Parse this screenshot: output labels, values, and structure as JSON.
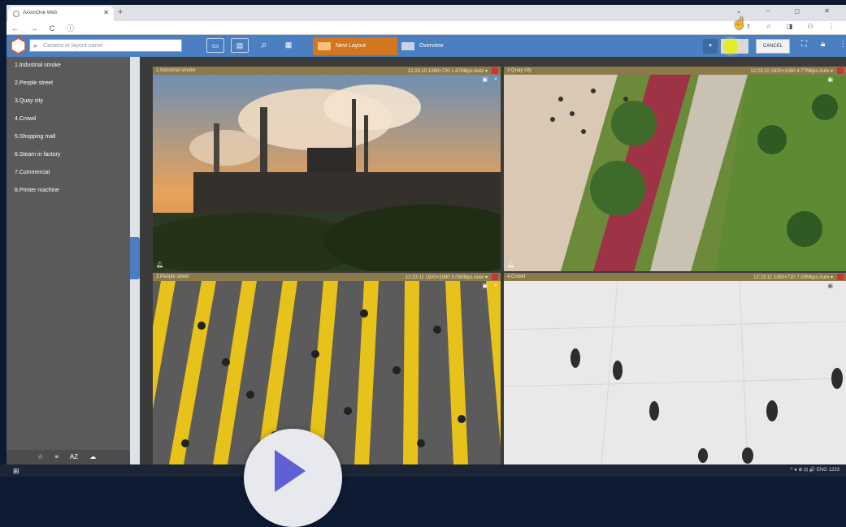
{
  "browser": {
    "tab_title": "AxxonOne Web",
    "tab_close": "✕",
    "new_tab": "+",
    "nav_icons": "← → C ⓘ",
    "right_icons": "⇪ ☆ ◨ ⚇ ⋮",
    "window_controls": "⌄ – ◻ ✕"
  },
  "toolbar": {
    "search_placeholder": "Camera or layout name",
    "layout_label": "New Layout",
    "overview_label": "Overview",
    "cancel_label": "CANCEL",
    "dropdown_caret": "▾"
  },
  "sidebar": {
    "items": [
      {
        "label": "1.Industrial smoke"
      },
      {
        "label": "2.People street"
      },
      {
        "label": "3.Quay city"
      },
      {
        "label": "4.Crowd"
      },
      {
        "label": "5.Shopping mall"
      },
      {
        "label": "6.Steam in factory"
      },
      {
        "label": "7.Commercial"
      },
      {
        "label": "8.Printer machine"
      }
    ],
    "footer": "☆ ≡ AZ ☁"
  },
  "tiles": [
    {
      "name": "1.Industrial smoke",
      "info": "12:23:10 1280×720 1.67Mbps Auto ▾"
    },
    {
      "name": "3.Quay city",
      "info": "12:23:10 1920×1080 4.77Mbps Auto ▾"
    },
    {
      "name": "2.People street",
      "info": "12:23:11 1920×1080 3.05Mbps Auto ▾"
    },
    {
      "name": "4.Crowd",
      "info": "12:23:11 1280×720 7.00Mbps Auto ▾"
    }
  ],
  "taskbar": {
    "tray": "^ ● ⊕ ⊡ 🔊 ENG",
    "time": "1223"
  },
  "colors": {
    "app_blue": "#4a7fc1",
    "layout_orange": "#d2761f",
    "tile_header": "#8b7a4a",
    "sidebar": "#5a5a5a"
  }
}
